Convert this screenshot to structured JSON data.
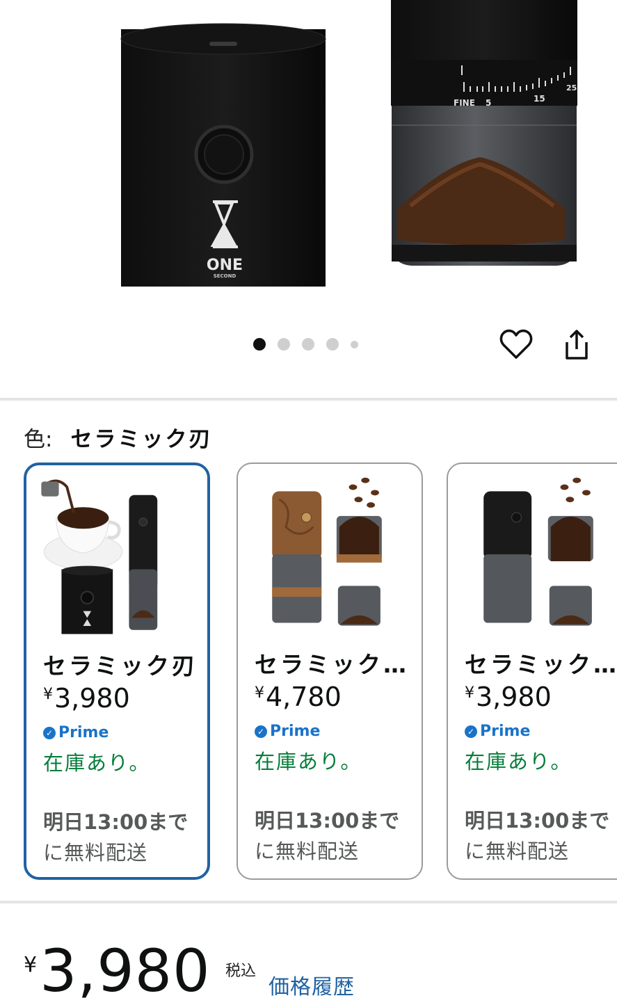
{
  "hero": {
    "brand_text": "ONE",
    "brand_sub": "SECOND",
    "dial_fine": "FINE",
    "dial_5": "5",
    "dial_15": "15",
    "dial_25": "25",
    "dot_count": 5,
    "active_dot": 0
  },
  "color": {
    "label": "色:",
    "value": "セラミック刃"
  },
  "variations": [
    {
      "name": "セラミック刃",
      "currency": "¥",
      "price": "3,980",
      "prime": "Prime",
      "stock": "在庫あり。",
      "delivery_line1": "明日13:00まで",
      "delivery_line2": "に無料配送",
      "selected": true
    },
    {
      "name": "セラミック…",
      "currency": "¥",
      "price": "4,780",
      "prime": "Prime",
      "stock": "在庫あり。",
      "delivery_line1": "明日13:00まで",
      "delivery_line2": "に無料配送",
      "selected": false
    },
    {
      "name": "セラミック…",
      "currency": "¥",
      "price": "3,980",
      "prime": "Prime",
      "stock": "在庫あり。",
      "delivery_line1": "明日13:00まで",
      "delivery_line2": "に無料配送",
      "selected": false
    }
  ],
  "price": {
    "currency": "¥",
    "amount": "3,980",
    "tax_note": "税込",
    "history_link": "価格履歴"
  },
  "colors": {
    "selected_border": "#2162a1",
    "prime_blue": "#1a73c8",
    "in_stock_green": "#067d39",
    "link_blue": "#2162a1"
  }
}
